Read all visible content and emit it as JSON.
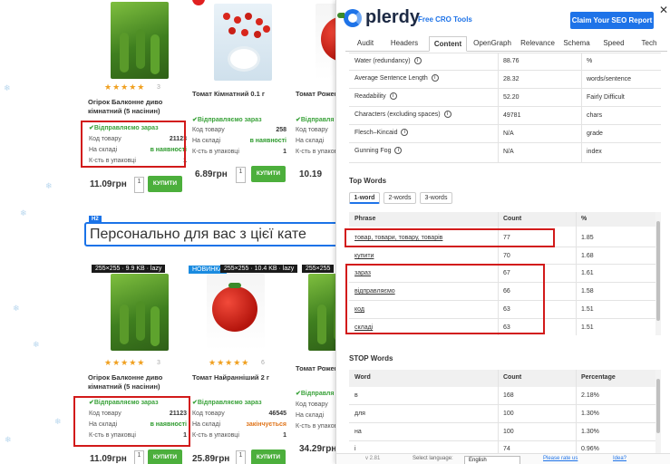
{
  "products": [
    {
      "name": "Огірок Балконне диво кімнатний (5 насінин)",
      "reviews": "3",
      "shipping": "Відправляємо зараз",
      "code_label": "Код товару",
      "code": "21123",
      "stock_label": "На складі",
      "stock": "в наявності",
      "pack_label": "К-сть в упаковці",
      "pack": "1",
      "price": "11.09грн",
      "qty": "1",
      "buy": "КУПИТИ"
    },
    {
      "name": "Томат Кімнатний 0.1 г",
      "shipping": "Відправляємо зараз",
      "code_label": "Код товару",
      "code": "258",
      "stock_label": "На складі",
      "stock": "в наявності",
      "pack_label": "К-сть в упаковці",
      "pack": "1",
      "price": "6.89грн",
      "qty": "1",
      "buy": "КУПИТИ"
    },
    {
      "name": "Томат Рожев",
      "shipping": "Відправля",
      "code_label": "Код товару",
      "stock_label": "На складі",
      "pack_label": "К-сть в упаков",
      "price": "10.19"
    },
    {
      "tag": "255×255 · 9.9 KB · lazy",
      "name": "Огірок Балконне диво кімнатний (5 насінин)",
      "reviews": "3",
      "shipping": "Відправляємо зараз",
      "code_label": "Код товару",
      "code": "21123",
      "stock_label": "На складі",
      "stock": "в наявності",
      "pack_label": "К-сть в упаковці",
      "pack": "1",
      "price": "11.09грн",
      "qty": "1",
      "buy": "КУПИТИ"
    },
    {
      "badge": "НОВИНКА",
      "tag": "255×255 · 10.4 KB · lazy",
      "name": "Томат Найранніший 2 г",
      "reviews": "6",
      "shipping": "Відправляємо зараз",
      "code_label": "Код товару",
      "code": "46545",
      "stock_label": "На складі",
      "stock": "закінчується",
      "pack_label": "К-сть в упаковці",
      "pack": "1",
      "price": "25.89грн",
      "qty": "1",
      "buy": "КУПИТИ"
    },
    {
      "tag": "255×255",
      "name": "Томат Рожев",
      "shipping": "Відправля",
      "code_label": "Код товару",
      "stock_label": "На складі",
      "pack_label": "К-сть в упаков",
      "price": "34.29грн"
    }
  ],
  "heading": {
    "tag": "H2",
    "text": "Персонально для вас з цієї кате"
  },
  "panel": {
    "logo": "plerdy",
    "tool": "Free CRO Tools",
    "claim": "Claim Your SEO Report",
    "close": "✕",
    "tabs": [
      "Audit",
      "Headers",
      "Content",
      "OpenGraph",
      "Relevance",
      "Schema",
      "Speed",
      "Tech"
    ],
    "active_tab": "Content",
    "metrics": [
      {
        "label": "Water (redundancy)",
        "info": true,
        "value": "88.76",
        "unit": "%"
      },
      {
        "label": "Average Sentence Length",
        "info": true,
        "value": "28.32",
        "unit": "words/sentence"
      },
      {
        "label": "Readability",
        "info": true,
        "value": "52.20",
        "unit": "Fairly Difficult"
      },
      {
        "label": "Characters (excluding spaces)",
        "info": true,
        "value": "49781",
        "unit": "chars"
      },
      {
        "label": "Flesch–Kincaid",
        "info": true,
        "value": "N/A",
        "unit": "grade"
      },
      {
        "label": "Gunning Fog",
        "info": true,
        "value": "N/A",
        "unit": "index"
      }
    ],
    "top_words_title": "Top Words",
    "word_tabs": [
      "1-word",
      "2-words",
      "3-words"
    ],
    "top_words_headers": [
      "Phrase",
      "Count",
      "%"
    ],
    "top_words": [
      {
        "phrase": "товар, товари, товару, товарів",
        "count": "77",
        "pct": "1.85"
      },
      {
        "phrase": "купити",
        "count": "70",
        "pct": "1.68"
      },
      {
        "phrase": "зараз",
        "count": "67",
        "pct": "1.61"
      },
      {
        "phrase": "відправляємо",
        "count": "66",
        "pct": "1.58"
      },
      {
        "phrase": "код",
        "count": "63",
        "pct": "1.51"
      },
      {
        "phrase": "складі",
        "count": "63",
        "pct": "1.51"
      }
    ],
    "stop_words_title": "STOP Words",
    "stop_headers": [
      "Word",
      "Count",
      "Percentage"
    ],
    "stop_words": [
      {
        "word": "в",
        "count": "168",
        "pct": "2.18%"
      },
      {
        "word": "для",
        "count": "100",
        "pct": "1.30%"
      },
      {
        "word": "на",
        "count": "100",
        "pct": "1.30%"
      },
      {
        "word": "і",
        "count": "74",
        "pct": "0.96%"
      }
    ],
    "footer": {
      "version": "v 2.81",
      "lang_label": "Select language:",
      "lang": "English",
      "rate": "Please rate us",
      "idea": "Idea?"
    }
  },
  "colors": {
    "accent": "#1e73e8",
    "buy": "#4caf3c",
    "highlight": "#d21a1a"
  }
}
